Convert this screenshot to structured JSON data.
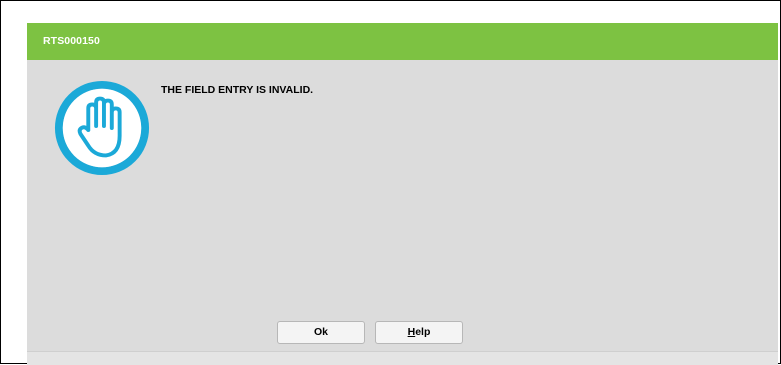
{
  "dialog": {
    "title": "RTS000150",
    "message": "THE FIELD ENTRY IS INVALID.",
    "icon": "stop-hand-icon"
  },
  "buttons": {
    "ok_label": "Ok",
    "help_label_first": "H",
    "help_label_rest": "elp"
  },
  "colors": {
    "titlebar": "#7dc242",
    "icon": "#1ba9d8",
    "dialog_bg": "#dcdcdc"
  }
}
